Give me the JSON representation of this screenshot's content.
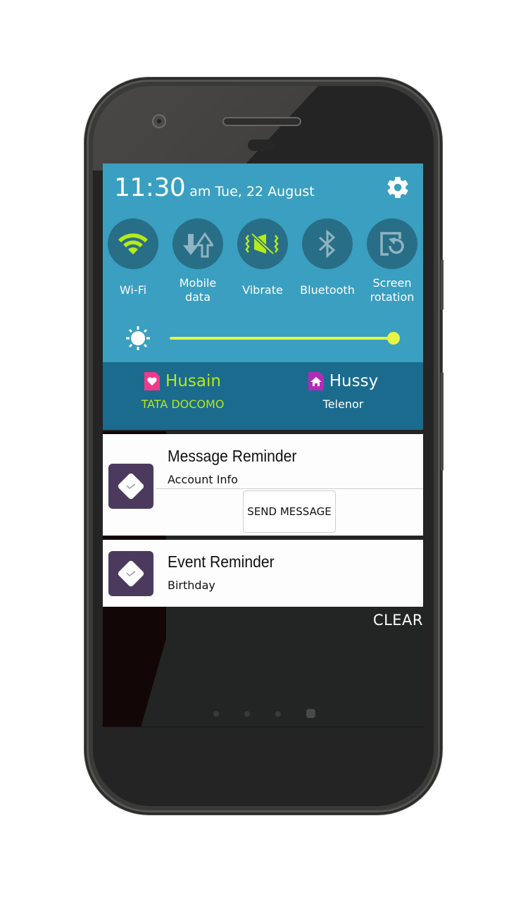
{
  "status": {
    "time": "11:30",
    "ampm_date": "am Tue, 22 August",
    "settings_icon": "gear-icon"
  },
  "quick_toggles": [
    {
      "label": "Wi-Fi",
      "icon": "wifi-icon",
      "active": true
    },
    {
      "label": "Mobile\ndata",
      "icon": "mobile-data-icon",
      "active": false
    },
    {
      "label": "Vibrate",
      "icon": "vibrate-icon",
      "active": true
    },
    {
      "label": "Bluetooth",
      "icon": "bluetooth-icon",
      "active": false
    },
    {
      "label": "Screen\nrotation",
      "icon": "screen-rotation-icon",
      "active": false
    }
  ],
  "brightness": {
    "icon": "sun-icon",
    "level_percent": 100
  },
  "sims": [
    {
      "name": "Husain",
      "carrier": "TATA DOCOMO",
      "icon": "sim-heart-icon",
      "active": true,
      "color": "#b7ea1a",
      "icon_color": "#ef3a8a"
    },
    {
      "name": "Hussy",
      "carrier": "Telenor",
      "icon": "sim-home-icon",
      "active": false,
      "color": "#ffffff",
      "icon_color": "#b32bb8"
    }
  ],
  "notifications": [
    {
      "title": "Message Reminder",
      "subtitle": "Account Info",
      "action": "SEND MESSAGE",
      "icon": "reminder-app-icon"
    },
    {
      "title": "Event Reminder",
      "subtitle": "Birthday",
      "icon": "reminder-app-icon"
    }
  ],
  "clear_label": "CLEAR",
  "page_indicator": {
    "count": 4,
    "active_index": 3
  },
  "colors": {
    "panel": "#3a9fc0",
    "sim_band": "#1b6b8e",
    "toggle_bg": "#286e86",
    "accent": "#b7ea1a",
    "slider": "#e8f542",
    "inactive_icon": "#8fb4c2"
  }
}
